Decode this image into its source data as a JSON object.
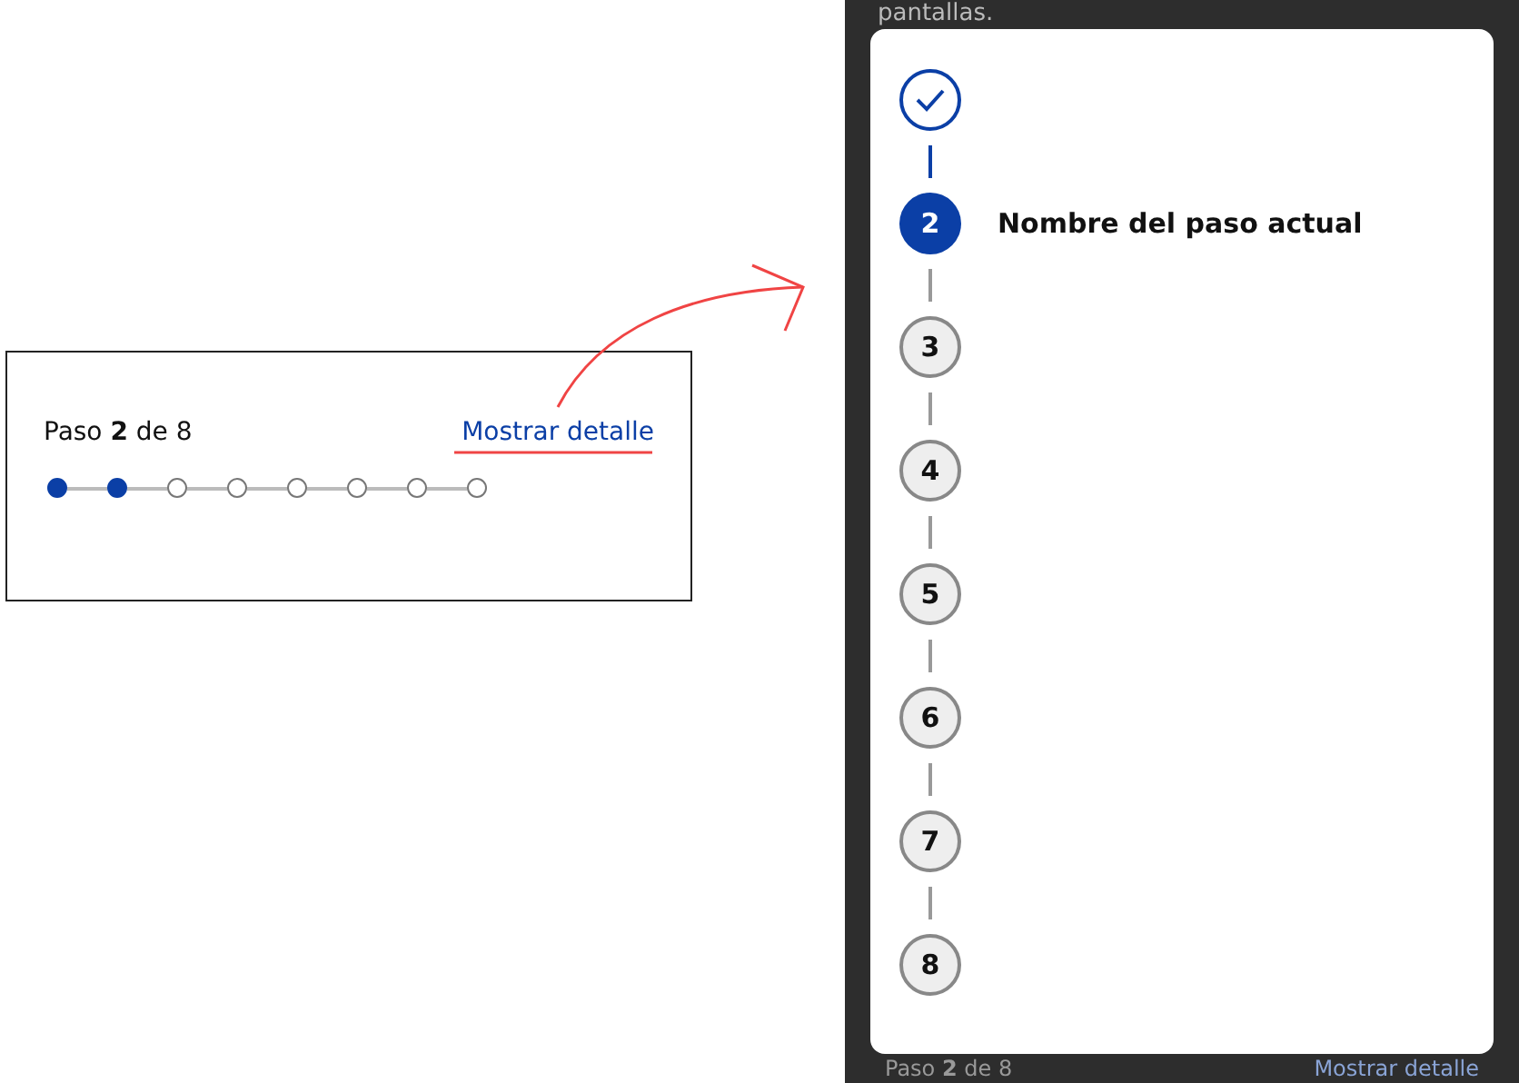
{
  "panel_top": {
    "text": "pantallas."
  },
  "compact_stepper": {
    "caption": "Paso **2** de 8",
    "link": "Mostrar detalle",
    "dots": [
      {
        "filled": true
      },
      {
        "filled": true
      },
      {
        "filled": false
      },
      {
        "filled": false
      },
      {
        "filled": false
      },
      {
        "filled": false
      },
      {
        "filled": false
      },
      {
        "filled": false
      }
    ]
  },
  "detail_stepper": {
    "steps": [
      {
        "done": true,
        "selected": false
      },
      {
        "number": "2",
        "done": false,
        "selected": true,
        "label": "Nombre del paso actual"
      },
      {
        "number": "3",
        "done": false,
        "selected": false
      },
      {
        "number": "4",
        "done": false,
        "selected": false
      },
      {
        "number": "5",
        "done": false,
        "selected": false
      },
      {
        "number": "6",
        "done": false,
        "selected": false
      },
      {
        "number": "7",
        "done": false,
        "selected": false
      },
      {
        "number": "8",
        "done": false,
        "selected": false
      }
    ]
  },
  "panel_bottom": {
    "caption": "Paso **2** de 8",
    "link": "Mostrar detalle"
  }
}
